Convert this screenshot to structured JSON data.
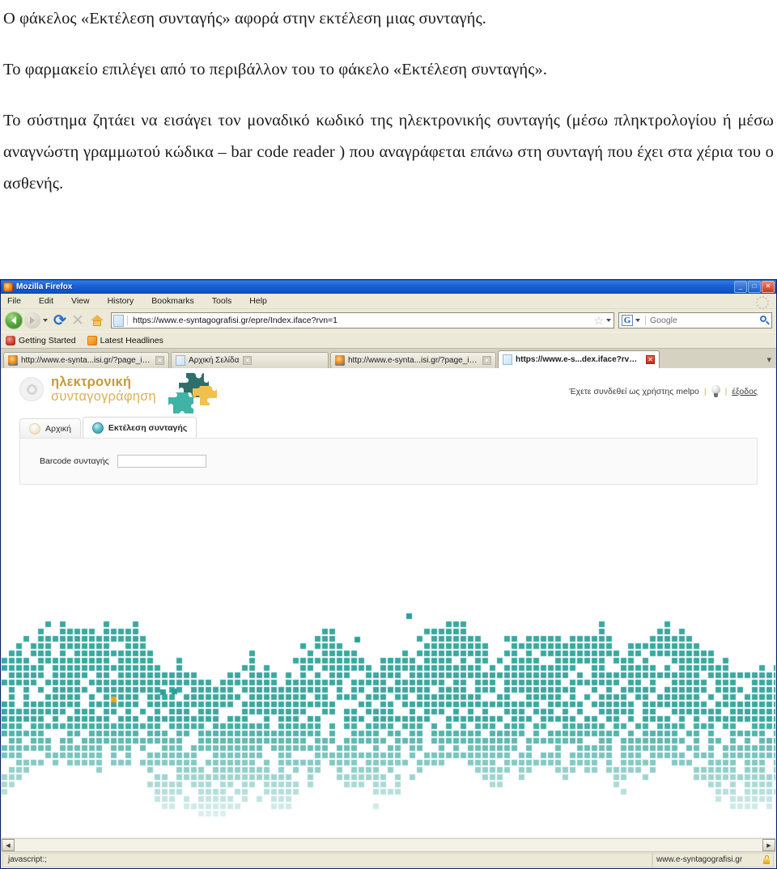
{
  "document": {
    "paragraphs": [
      "Ο φάκελος «Εκτέλεση συνταγής» αφορά στην εκτέλεση μιας συνταγής.",
      "Το φαρμακείο επιλέγει από το περιβάλλον του το φάκελο «Εκτέλεση συνταγής».",
      "Το σύστημα ζητάει να εισάγει τον μοναδικό κωδικό της ηλεκτρονικής συνταγής (μέσω πληκτρολογίου ή μέσω αναγνώστη γραμμωτού κώδικα – bar code reader ) που αναγράφεται επάνω στη συνταγή που έχει στα χέρια του ο ασθενής."
    ]
  },
  "browser": {
    "title": "Mozilla Firefox",
    "window_buttons": {
      "minimize": "_",
      "maximize": "□",
      "close": "✕"
    },
    "menu": [
      {
        "label": "File"
      },
      {
        "label": "Edit"
      },
      {
        "label": "View"
      },
      {
        "label": "History"
      },
      {
        "label": "Bookmarks"
      },
      {
        "label": "Tools"
      },
      {
        "label": "Help"
      }
    ],
    "toolbar": {
      "back_title": "Back",
      "forward_title": "Forward",
      "reload_glyph": "⟳",
      "stop_glyph": "✕",
      "home_title": "Home",
      "url": "https://www.e-syntagografisi.gr/epre/Index.iface?rvn=1",
      "bookmark_star": "☆",
      "star_caret": "▾",
      "search_engine": "G",
      "search_caret": "▾",
      "search_placeholder": "Google"
    },
    "bookmarks": [
      {
        "label": "Getting Started",
        "icon": "firefox-icon"
      },
      {
        "label": "Latest Headlines",
        "icon": "rss-icon"
      }
    ],
    "tabs": [
      {
        "label": "http://www.e-synta...isi.gr/?page_id=63",
        "active": false,
        "icon": "firefox-icon",
        "close": "✕"
      },
      {
        "label": "Αρχική Σελίδα",
        "active": false,
        "icon": "page-icon",
        "close": "✕"
      },
      {
        "label": "http://www.e-synta...isi.gr/?page_id=63",
        "active": false,
        "icon": "firefox-icon",
        "close": "✕"
      },
      {
        "label": "https://www.e-s...dex.iface?rvn=1",
        "active": true,
        "icon": "page-icon",
        "close": "✕"
      }
    ],
    "tab_list_caret": "▾",
    "statusbar": {
      "left": "javascript:;",
      "right": "www.e-syntagografisi.gr",
      "lock_icon": "lock-icon"
    },
    "scrollbar": {
      "left_arrow": "◀",
      "right_arrow": "▶"
    }
  },
  "page": {
    "logo": {
      "line1": "ηλεκτρονική",
      "line2": "συνταγογράφηση"
    },
    "user_bar": {
      "text": "Έχετε συνδεθεί ως χρήστης melpo",
      "separator": "|",
      "bulb_icon": "lightbulb-icon",
      "logout": "έξοδος"
    },
    "tabs": [
      {
        "label": "Αρχική",
        "active": false
      },
      {
        "label": "Εκτέλεση συνταγής",
        "active": true
      }
    ],
    "form": {
      "barcode_label": "Barcode συνταγής",
      "barcode_value": "",
      "barcode_placeholder": ""
    },
    "colors": {
      "teal": "#2aa198",
      "teal_light": "#5cc4bb",
      "orange": "#f0a323",
      "logo_gold": "#c79a3e",
      "puzzle_dark_teal": "#2e6f6b",
      "puzzle_light_teal": "#3fb3a5",
      "puzzle_gold": "#f0c24d"
    }
  }
}
